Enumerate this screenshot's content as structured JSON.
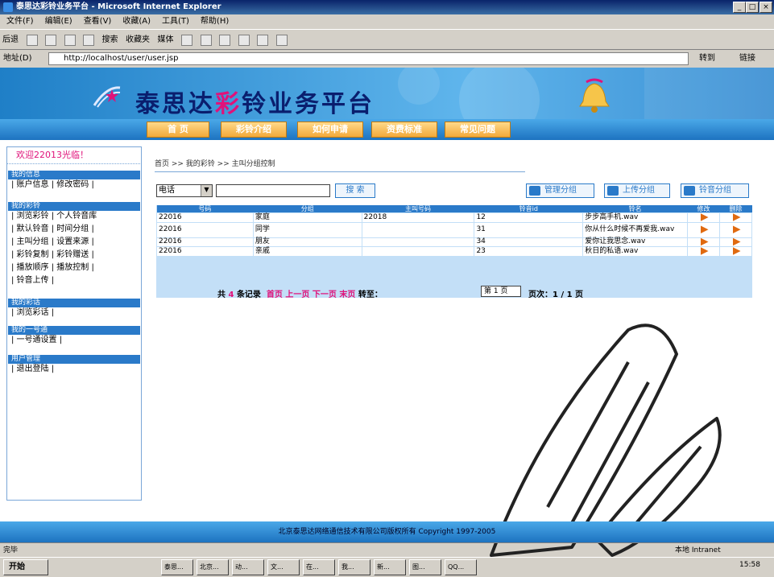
{
  "window": {
    "title": "泰思达彩铃业务平台 - Microsoft Internet Explorer",
    "min": "_",
    "max": "□",
    "close": "×"
  },
  "menu": [
    "文件(F)",
    "编辑(E)",
    "查看(V)",
    "收藏(A)",
    "工具(T)",
    "帮助(H)"
  ],
  "toolbar": {
    "back": "后退",
    "search": "搜索",
    "favorites": "收藏夹",
    "media": "媒体"
  },
  "address": {
    "label": "地址(D)",
    "url": "http://localhost/user/user.jsp",
    "go": "转到",
    "links": "链接"
  },
  "banner": {
    "title_a": "泰思达",
    "title_b": "彩",
    "title_c": "铃业务平台"
  },
  "nav": [
    "首 页",
    "彩铃介绍",
    "如何申请",
    "资费标准",
    "常见问题"
  ],
  "sidebar": {
    "welcome": "欢迎22013光临！",
    "sections": [
      {
        "head": "我的信息",
        "links": [
          "| 账户信息 | 修改密码 |"
        ]
      },
      {
        "head": "我的彩铃",
        "links": [
          "| 浏览彩铃 | 个人铃音库",
          "| 默认铃音 | 时间分组 |",
          "| 主叫分组 | 设置来源 |",
          "| 彩铃复制 | 彩铃赠送 |",
          "| 播放顺序 | 播放控制 |",
          "| 铃音上传 |"
        ]
      },
      {
        "head": "我的彩话",
        "links": [
          "| 浏览彩话 |"
        ]
      },
      {
        "head": "我的一号通",
        "links": [
          "| 一号通设置 |"
        ]
      },
      {
        "head": "用户管理",
        "links": [
          "| 退出登陆 |"
        ]
      }
    ]
  },
  "breadcrumb": "首页 >> 我的彩铃 >> 主叫分组控制",
  "search": {
    "type": "电话",
    "button": "搜 索"
  },
  "actions": [
    "管理分组",
    "上传分组",
    "铃音分组"
  ],
  "table": {
    "headers": [
      "号码",
      "分组",
      "主叫号码",
      "铃音id",
      "铃名",
      "修改",
      "删除"
    ],
    "rows": [
      [
        "22016",
        "家庭",
        "22018",
        "12",
        "步步高手机.wav"
      ],
      [
        "22016",
        "同学",
        "",
        "31",
        "你从什么时候不再爱我.wav"
      ],
      [
        "22016",
        "朋友",
        "",
        "34",
        "爱你让我思念.wav"
      ],
      [
        "22016",
        "亲戚",
        "",
        "23",
        "秋日的私语.wav"
      ]
    ]
  },
  "pager": {
    "total_pre": "共",
    "total": "4",
    "total_post": "条记录",
    "first": "首页",
    "prev": "上一页",
    "next": "下一页",
    "last": "末页",
    "goto": "转至：",
    "page_sel": "第 1 页",
    "pages": "页次：1 / 1 页"
  },
  "footer": "北京泰思达网络通信技术有限公司版权所有 Copyright 1997-2005",
  "status": {
    "done": "完毕",
    "zone": "本地 Intranet"
  },
  "taskbar": {
    "start": "开始",
    "tasks": [
      "泰思...",
      "北京...",
      "动...",
      "文...",
      "在...",
      "我...",
      "新...",
      "图...",
      "QQ..."
    ],
    "clock": "15:58"
  }
}
